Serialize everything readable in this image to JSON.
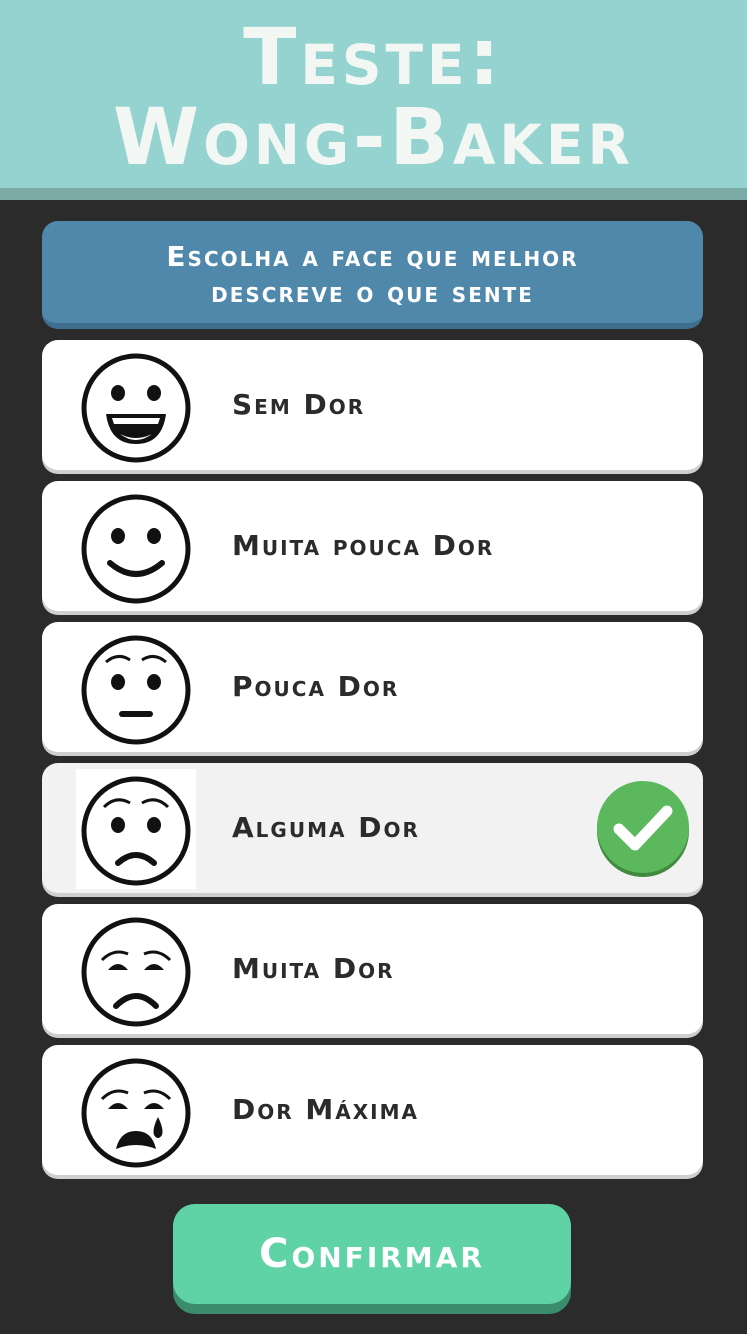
{
  "header": {
    "title_line1": "Teste:",
    "title_line2": "Wong-Baker"
  },
  "instruction": {
    "line1": "Escolha a face que melhor",
    "line2": "descreve o que sente"
  },
  "options": [
    {
      "label": "Sem Dor",
      "face_icon": "face-no-hurt-icon"
    },
    {
      "label": "Muita pouca Dor",
      "face_icon": "face-hurts-little-bit-icon"
    },
    {
      "label": "Pouca Dor",
      "face_icon": "face-hurts-little-more-icon"
    },
    {
      "label": "Alguma Dor",
      "face_icon": "face-hurts-even-more-icon",
      "selected": true
    },
    {
      "label": "Muita Dor",
      "face_icon": "face-hurts-whole-lot-icon"
    },
    {
      "label": "Dor Máxima",
      "face_icon": "face-hurts-worst-icon"
    }
  ],
  "confirm_label": "Confirmar",
  "colors": {
    "header": "#94d3d0",
    "instruction": "#4f88ab",
    "confirm": "#5fd3a6",
    "check": "#5cb85c",
    "background": "#2b2b2b"
  }
}
